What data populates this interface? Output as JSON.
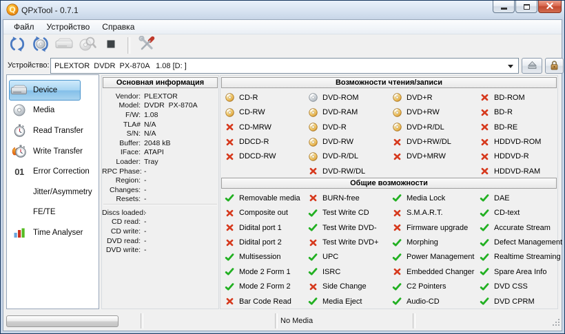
{
  "window": {
    "title": "QPxTool - 0.7.1"
  },
  "menu": {
    "items": [
      {
        "name": "file",
        "label": "Файл"
      },
      {
        "name": "device",
        "label": "Устройство"
      },
      {
        "name": "help",
        "label": "Справка"
      }
    ]
  },
  "toolbar": {
    "buttons": [
      {
        "name": "refresh-devices",
        "icon": "refresh-icon",
        "enabled": true
      },
      {
        "name": "refresh-media",
        "icon": "refresh-media-icon",
        "enabled": true
      },
      {
        "name": "device-control",
        "icon": "drive-toolbar-icon",
        "enabled": false
      },
      {
        "name": "scan-media",
        "icon": "scan-media-icon",
        "enabled": false
      },
      {
        "name": "stop",
        "icon": "stop-icon",
        "enabled": true
      },
      {
        "separator": true
      },
      {
        "name": "preferences",
        "icon": "tools-icon",
        "enabled": true
      }
    ]
  },
  "device_bar": {
    "label": "Устройство:",
    "value": "PLEXTOR  DVDR  PX-870A   1.08 [D: ]",
    "eject_icon": "eject-icon",
    "lock_icon": "lock-icon"
  },
  "sidebar": {
    "items": [
      {
        "label": "Device",
        "icon": "drive-icon",
        "selected": true
      },
      {
        "label": "Media",
        "icon": "media-icon",
        "selected": false
      },
      {
        "label": "Read Transfer",
        "icon": "stopwatch-icon",
        "selected": false
      },
      {
        "label": "Write Transfer",
        "icon": "stopwatch-flame-icon",
        "selected": false
      },
      {
        "label": "Error Correction",
        "icon": "error01-icon",
        "selected": false
      },
      {
        "label": "Jitter/Asymmetry",
        "icon": "none",
        "selected": false
      },
      {
        "label": "FE/TE",
        "icon": "none",
        "selected": false
      },
      {
        "label": "Time Analyser",
        "icon": "bars-icon",
        "selected": false
      }
    ]
  },
  "info": {
    "title": "Основная информация",
    "rows": [
      [
        "Vendor:",
        "PLEXTOR"
      ],
      [
        "Model:",
        "DVDR  PX-870A"
      ],
      [
        "F/W:",
        "1.08"
      ],
      [
        "TLA#",
        "N/A"
      ],
      [
        "S/N:",
        "N/A"
      ],
      [
        "Buffer:",
        "2048 kB"
      ],
      [
        "IFace:",
        "ATAPI"
      ],
      [
        "Loader:",
        "Tray"
      ],
      [
        "RPC Phase:",
        "-"
      ],
      [
        "Region:",
        "-"
      ],
      [
        "Changes:",
        "-"
      ],
      [
        "Resets:",
        "-"
      ]
    ],
    "rows2": [
      [
        "Discs loaded:",
        "-"
      ],
      [
        "CD read:",
        "-"
      ],
      [
        "CD write:",
        "-"
      ],
      [
        "DVD read:",
        "-"
      ],
      [
        "DVD write:",
        "-"
      ]
    ]
  },
  "capabilities": {
    "title": "Возможности чтения/записи",
    "columns": [
      [
        {
          "label": "CD-R",
          "state": "disc"
        },
        {
          "label": "CD-RW",
          "state": "disc"
        },
        {
          "label": "CD-MRW",
          "state": "no"
        },
        {
          "label": "DDCD-R",
          "state": "no"
        },
        {
          "label": "DDCD-RW",
          "state": "no"
        }
      ],
      [
        {
          "label": "DVD-ROM",
          "state": "rom"
        },
        {
          "label": "DVD-RAM",
          "state": "disc"
        },
        {
          "label": "DVD-R",
          "state": "disc"
        },
        {
          "label": "DVD-RW",
          "state": "disc"
        },
        {
          "label": "DVD-R/DL",
          "state": "disc"
        },
        {
          "label": "DVD-RW/DL",
          "state": "no"
        }
      ],
      [
        {
          "label": "DVD+R",
          "state": "disc"
        },
        {
          "label": "DVD+RW",
          "state": "disc"
        },
        {
          "label": "DVD+R/DL",
          "state": "disc"
        },
        {
          "label": "DVD+RW/DL",
          "state": "no"
        },
        {
          "label": "DVD+MRW",
          "state": "no"
        }
      ],
      [
        {
          "label": "BD-ROM",
          "state": "no"
        },
        {
          "label": "BD-R",
          "state": "no"
        },
        {
          "label": "BD-RE",
          "state": "no"
        },
        {
          "label": "HDDVD-ROM",
          "state": "no"
        },
        {
          "label": "HDDVD-R",
          "state": "no"
        },
        {
          "label": "HDDVD-RAM",
          "state": "no"
        }
      ]
    ]
  },
  "general": {
    "title": "Общие возможности",
    "columns": [
      [
        {
          "label": "Removable media",
          "state": "yes"
        },
        {
          "label": "Composite out",
          "state": "no"
        },
        {
          "label": "Didital port 1",
          "state": "no"
        },
        {
          "label": "Didital port 2",
          "state": "no"
        },
        {
          "label": "Multisession",
          "state": "yes"
        },
        {
          "label": "Mode 2 Form 1",
          "state": "yes"
        },
        {
          "label": "Mode 2 Form 2",
          "state": "yes"
        },
        {
          "label": "Bar Code Read",
          "state": "no"
        }
      ],
      [
        {
          "label": "BURN-free",
          "state": "no"
        },
        {
          "label": "Test Write CD",
          "state": "yes"
        },
        {
          "label": "Test Write DVD-",
          "state": "yes"
        },
        {
          "label": "Test Write DVD+",
          "state": "no"
        },
        {
          "label": "UPC",
          "state": "yes"
        },
        {
          "label": "ISRC",
          "state": "yes"
        },
        {
          "label": "Side Change",
          "state": "no"
        },
        {
          "label": "Media Eject",
          "state": "yes"
        }
      ],
      [
        {
          "label": "Media Lock",
          "state": "yes"
        },
        {
          "label": "S.M.A.R.T.",
          "state": "no"
        },
        {
          "label": "Firmware upgrade",
          "state": "no"
        },
        {
          "label": "Morphing",
          "state": "yes"
        },
        {
          "label": "Power Management",
          "state": "yes"
        },
        {
          "label": "Embedded Changer",
          "state": "no"
        },
        {
          "label": "C2 Pointers",
          "state": "yes"
        },
        {
          "label": "Audio-CD",
          "state": "yes"
        }
      ],
      [
        {
          "label": "DAE",
          "state": "yes"
        },
        {
          "label": "CD-text",
          "state": "yes"
        },
        {
          "label": "Accurate Stream",
          "state": "yes"
        },
        {
          "label": "Defect Management",
          "state": "yes"
        },
        {
          "label": "Realtime Streaming",
          "state": "yes"
        },
        {
          "label": "Spare Area Info",
          "state": "yes"
        },
        {
          "label": "DVD CSS",
          "state": "yes"
        },
        {
          "label": "DVD CPRM",
          "state": "yes"
        }
      ]
    ]
  },
  "statusbar": {
    "media_status": "No Media"
  },
  "colors": {
    "check_green": "#22b022",
    "cross_red": "#d6391d",
    "arc_blue": "#4a7ac2",
    "close_red": "#c34a30",
    "selection_blue": "#84bfe9"
  }
}
